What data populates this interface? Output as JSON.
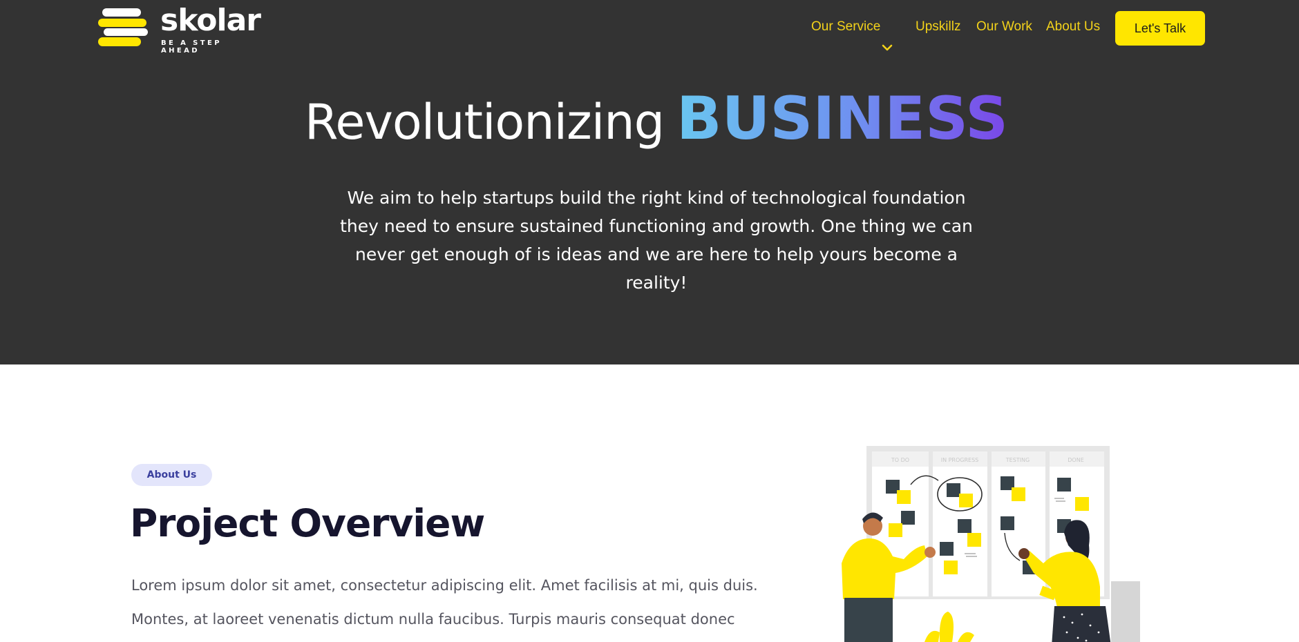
{
  "header": {
    "logo_text": "skolar",
    "logo_tagline": "BE A STEP AHEAD",
    "nav": [
      {
        "label": "Our Service",
        "has_dropdown": true
      },
      {
        "label": "Upskillz"
      },
      {
        "label": "Our Work"
      },
      {
        "label": "About Us"
      }
    ],
    "cta_label": "Let's Talk"
  },
  "hero": {
    "title_plain": "Revolutionizing",
    "title_highlight": "BUSINESS",
    "description": "We aim to help startups build the right kind of technological foundation they need to ensure sustained functioning and growth. One thing we can never get enough of is ideas and we are here to help yours become a reality!"
  },
  "about": {
    "badge": "About Us",
    "title": "Project Overview",
    "body_line_1": "Lorem ipsum dolor sit amet, consectetur adipiscing elit. Amet facilisis at mi, quis duis.",
    "body_line_2": "Montes, at laoreet venenatis dictum nulla faucibus. Turpis mauris consequat donec"
  },
  "illustration": {
    "board_columns": [
      "TO DO",
      "IN PROGRESS",
      "TESTING",
      "DONE"
    ]
  },
  "colors": {
    "header_bg": "#333333",
    "accent_yellow": "#ffe600",
    "nav_text": "#f3d21a",
    "gradient_start": "#6ac6f0",
    "gradient_end": "#7a47e8",
    "badge_bg": "#e3e5fb",
    "title_dark": "#16152e"
  }
}
